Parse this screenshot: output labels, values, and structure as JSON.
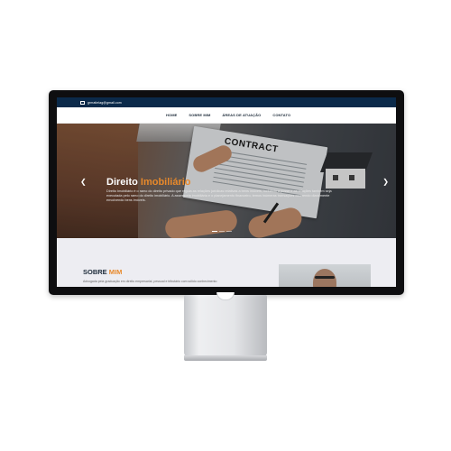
{
  "topbar": {
    "email_icon": "mail-icon",
    "email": "grmatielag@gmail.com"
  },
  "nav": {
    "items": [
      {
        "label": "HOME"
      },
      {
        "label": "SOBRE MIM"
      },
      {
        "label": "ÁREAS DE ATUAÇÃO"
      },
      {
        "label": "CONTATO"
      }
    ]
  },
  "hero": {
    "contract_word": "CONTRACT",
    "title_main": "Direito",
    "title_accent": "Imobiliário",
    "text": "Direito Imobiliário é o ramo do direito privado que regula as relações jurídicas relativas a bens imóveis, incluindo a posse e as relações também seja executada pelo ramo do direito imobiliário. A assessoria imobiliária e o planejamento financeiro, temos inúmeras transações ocorrendo diariamente envolvendo bens imóveis.",
    "prev_icon": "chevron-left-icon",
    "next_icon": "chevron-right-icon",
    "slides": 3,
    "active_slide": 0
  },
  "about": {
    "title_main": "SOBRE",
    "title_accent": "MIM",
    "text": "Advogada pela graduação em direito empresarial, pessoal e tributário com sólido conhecimento"
  },
  "colors": {
    "topbar": "#0b2a4a",
    "accent": "#e8892b",
    "about_bg": "#ededf2"
  }
}
